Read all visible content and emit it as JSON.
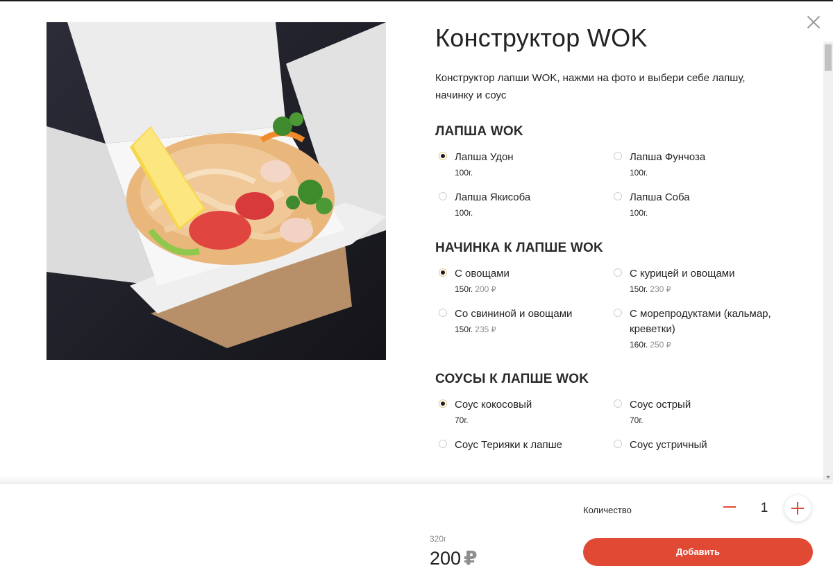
{
  "header": {
    "title": "Конструктор WOK",
    "description": "Конструктор лапши WOK, нажми на фото и выбери себе лапшу, начинку и соус"
  },
  "sections": [
    {
      "title": "ЛАПША WOK",
      "options": [
        {
          "name": "Лапша Удон",
          "weight": "100г.",
          "price": "",
          "checked": true
        },
        {
          "name": "Лапша Фунчоза",
          "weight": "100г.",
          "price": "",
          "checked": false
        },
        {
          "name": "Лапша Якисоба",
          "weight": "100г.",
          "price": "",
          "checked": false
        },
        {
          "name": "Лапша Соба",
          "weight": "100г.",
          "price": "",
          "checked": false
        }
      ]
    },
    {
      "title": "НАЧИНКА К ЛАПШЕ WOK",
      "options": [
        {
          "name": "С овощами",
          "weight": "150г.",
          "price": "200",
          "checked": true
        },
        {
          "name": "С курицей и овощами",
          "weight": "150г.",
          "price": "230",
          "checked": false
        },
        {
          "name": "Со свининой и овощами",
          "weight": "150г.",
          "price": "235",
          "checked": false
        },
        {
          "name": "С морепродуктами (кальмар, креветки)",
          "weight": "160г.",
          "price": "250",
          "checked": false
        }
      ]
    },
    {
      "title": "СОУСЫ К ЛАПШЕ WOK",
      "options": [
        {
          "name": "Соус кокосовый",
          "weight": "70г.",
          "price": "",
          "checked": true
        },
        {
          "name": "Соус острый",
          "weight": "70г.",
          "price": "",
          "checked": false
        },
        {
          "name": "Соус Терияки к лапше",
          "weight": "",
          "price": "",
          "checked": false
        },
        {
          "name": "Соус устричный",
          "weight": "",
          "price": "",
          "checked": false
        }
      ]
    }
  ],
  "currency_symbol": "₽",
  "footer": {
    "quantity_label": "Количество",
    "quantity_value": "1",
    "total_weight": "320г",
    "total_price": "200",
    "add_button_label": "Добавить"
  },
  "colors": {
    "accent": "#e04a35",
    "price_muted": "#8e8e8e"
  },
  "icons": {
    "close": "close-icon",
    "minus": "minus-icon",
    "plus": "plus-icon"
  }
}
